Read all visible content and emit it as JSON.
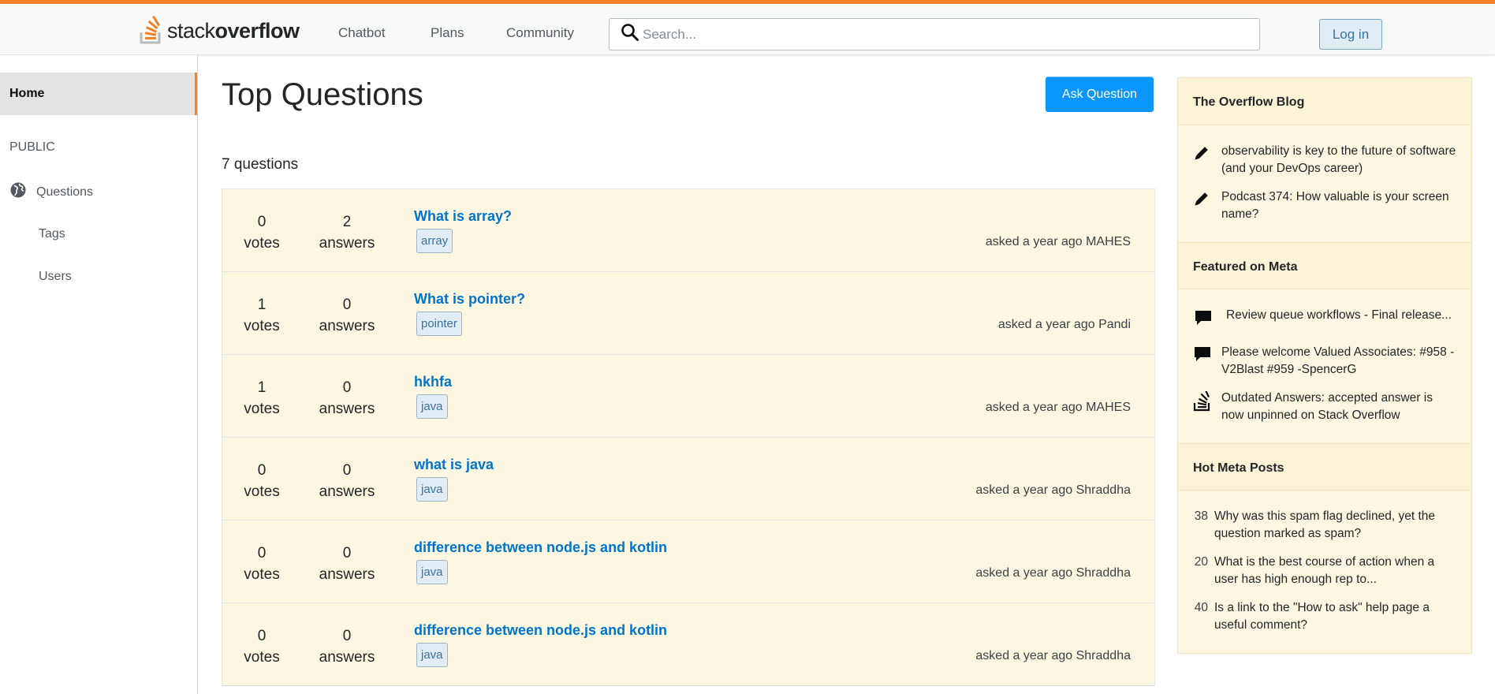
{
  "header": {
    "logo_text_light": "stack",
    "logo_text_bold": "overflow",
    "nav": [
      "Chatbot",
      "Plans",
      "Community"
    ],
    "search_placeholder": "Search...",
    "login_label": "Log in",
    "accent_color": "#f48225"
  },
  "sidebar": {
    "home": "Home",
    "public": "PUBLIC",
    "questions": "Questions",
    "tags": "Tags",
    "users": "Users"
  },
  "main": {
    "title": "Top Questions",
    "ask_button": "Ask Question",
    "count_label": "7 questions",
    "questions": [
      {
        "votes": "0",
        "votes_label": "votes",
        "answers": "2",
        "answers_label": "answers",
        "title": "What is array?",
        "tag": "array",
        "asked": "asked a year ago MAHES"
      },
      {
        "votes": "1",
        "votes_label": "votes",
        "answers": "0",
        "answers_label": "answers",
        "title": "What is pointer?",
        "tag": "pointer",
        "asked": "asked a year ago Pandi"
      },
      {
        "votes": "1",
        "votes_label": "votes",
        "answers": "0",
        "answers_label": "answers",
        "title": "hkhfa",
        "tag": "java",
        "asked": "asked a year ago MAHES"
      },
      {
        "votes": "0",
        "votes_label": "votes",
        "answers": "0",
        "answers_label": "answers",
        "title": "what is java",
        "tag": "java",
        "asked": "asked a year ago Shraddha"
      },
      {
        "votes": "0",
        "votes_label": "votes",
        "answers": "0",
        "answers_label": "answers",
        "title": "difference between node.js and kotlin",
        "tag": "java",
        "asked": "asked a year ago Shraddha"
      },
      {
        "votes": "0",
        "votes_label": "votes",
        "answers": "0",
        "answers_label": "answers",
        "title": "difference between node.js and kotlin",
        "tag": "java",
        "asked": "asked a year ago Shraddha"
      }
    ]
  },
  "right": {
    "blog": {
      "heading": "The Overflow Blog",
      "items": [
        {
          "icon": "pencil-icon",
          "text": "observability is key to the future of software (and your DevOps career)"
        },
        {
          "icon": "pencil-icon",
          "text": "Podcast 374: How valuable is your screen name?"
        }
      ]
    },
    "meta": {
      "heading": "Featured on Meta",
      "items": [
        {
          "icon": "chat-bubble-icon",
          "text": "Review queue workflows - Final release..."
        },
        {
          "icon": "chat-bubble-icon",
          "text": "Please welcome Valued Associates: #958 - V2Blast #959 -SpencerG"
        },
        {
          "icon": "stack-logo-icon",
          "text": "Outdated Answers: accepted answer is now unpinned on Stack Overflow"
        }
      ]
    },
    "hot": {
      "heading": "Hot Meta Posts",
      "items": [
        {
          "num": "38",
          "text": "Why was this spam flag declined, yet the question marked as spam?"
        },
        {
          "num": "20",
          "text": "What is the best course of action when a user has high enough rep to..."
        },
        {
          "num": "40",
          "text": "Is a link to the \"How to ask\" help page a useful comment?"
        }
      ]
    }
  }
}
